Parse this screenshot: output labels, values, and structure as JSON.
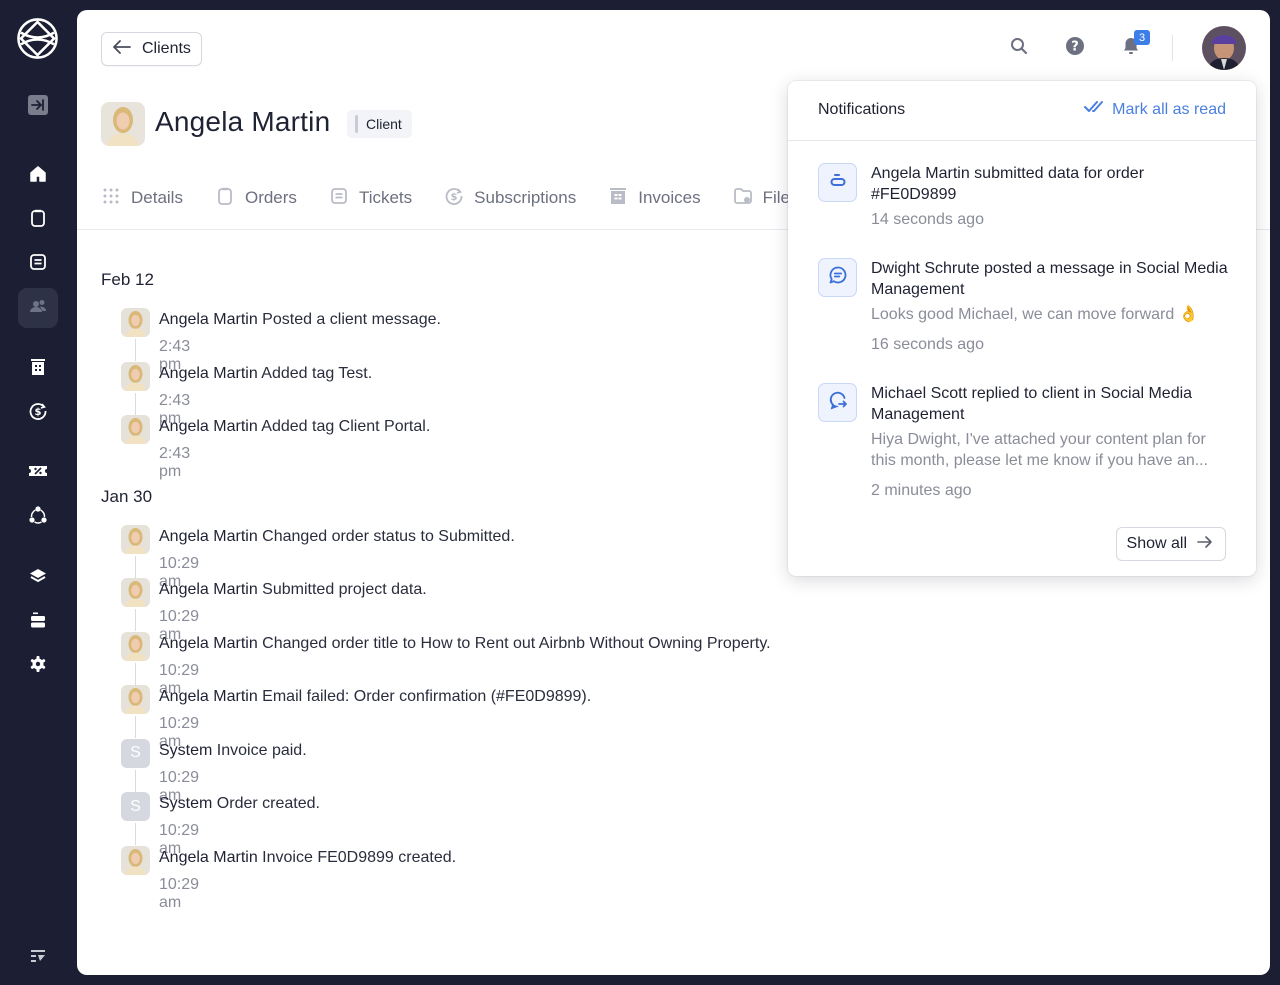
{
  "sidebar": {
    "items": [
      {
        "name": "collapse-sidebar",
        "icon": "arrow-to-right-icon",
        "active": false
      },
      {
        "name": "home",
        "icon": "home-icon",
        "active": false
      },
      {
        "name": "orders",
        "icon": "clipboard-icon",
        "active": false
      },
      {
        "name": "tickets",
        "icon": "ticket-message-icon",
        "active": false
      },
      {
        "name": "clients",
        "icon": "users-icon",
        "active": true
      },
      {
        "name": "invoices",
        "icon": "invoice-icon",
        "active": false
      },
      {
        "name": "subscriptions",
        "icon": "subscription-dollar-icon",
        "active": false
      },
      {
        "name": "coupons",
        "icon": "coupon-percent-icon",
        "active": false
      },
      {
        "name": "integrations",
        "icon": "network-icon",
        "active": false
      },
      {
        "name": "services",
        "icon": "layers-icon",
        "active": false
      },
      {
        "name": "team",
        "icon": "briefcase-icon",
        "active": false
      },
      {
        "name": "settings",
        "icon": "gear-icon",
        "active": false
      },
      {
        "name": "changelog",
        "icon": "filter-lines-icon",
        "active": false
      }
    ]
  },
  "header": {
    "back_label": "Clients",
    "notification_count": "3"
  },
  "profile": {
    "name": "Angela Martin",
    "role": "Client"
  },
  "tabs": [
    {
      "label": "Details",
      "icon": "grid-dots-icon"
    },
    {
      "label": "Orders",
      "icon": "clipboard-icon"
    },
    {
      "label": "Tickets",
      "icon": "ticket-message-icon"
    },
    {
      "label": "Subscriptions",
      "icon": "subscription-dollar-icon"
    },
    {
      "label": "Invoices",
      "icon": "invoice-icon"
    },
    {
      "label": "Files",
      "icon": "folder-icon"
    }
  ],
  "activity": [
    {
      "date": "Feb 12",
      "events": [
        {
          "actor": "Angela Martin",
          "type": "user",
          "text": "Posted a client message.",
          "time": "2:43 pm"
        },
        {
          "actor": "Angela Martin",
          "type": "user",
          "text": "Added tag Test.",
          "time": "2:43 pm"
        },
        {
          "actor": "Angela Martin",
          "type": "user",
          "text": "Added tag Client Portal.",
          "time": "2:43 pm"
        }
      ]
    },
    {
      "date": "Jan 30",
      "events": [
        {
          "actor": "Angela Martin",
          "type": "user",
          "text": "Changed order status to Submitted.",
          "time": "10:29 am"
        },
        {
          "actor": "Angela Martin",
          "type": "user",
          "text": "Submitted project data.",
          "time": "10:29 am"
        },
        {
          "actor": "Angela Martin",
          "type": "user",
          "text": "Changed order title to How to Rent out Airbnb Without Owning Property.",
          "time": "10:29 am"
        },
        {
          "actor": "Angela Martin",
          "type": "user",
          "text": "Email failed: Order confirmation (#FE0D9899).",
          "time": "10:29 am"
        },
        {
          "actor": "System",
          "type": "system",
          "initial": "S",
          "text": "Invoice paid.",
          "time": "10:29 am"
        },
        {
          "actor": "System",
          "type": "system",
          "initial": "S",
          "text": "Order created.",
          "time": "10:29 am"
        },
        {
          "actor": "Angela Martin",
          "type": "user",
          "text": "Invoice FE0D9899 created.",
          "time": "10:29 am"
        }
      ]
    }
  ],
  "notifications": {
    "title": "Notifications",
    "mark_all_label": "Mark all as read",
    "show_all_label": "Show all",
    "items": [
      {
        "icon": "order-data-icon",
        "title": "Angela Martin submitted data for order #FE0D9899",
        "preview": "",
        "time": "14 seconds ago"
      },
      {
        "icon": "message-icon",
        "title": "Dwight Schrute posted a message in Social Media Management",
        "preview": "Looks good Michael, we can move forward 👌",
        "time": "16 seconds ago"
      },
      {
        "icon": "reply-icon",
        "title": "Michael Scott replied to client in Social Media Management",
        "preview": "Hiya Dwight, I've attached your content plan for this month, please let me know if you have an...",
        "time": "2 minutes ago"
      }
    ]
  },
  "colors": {
    "sidebar_bg": "#1c1f33",
    "accent": "#4a7fe0",
    "badge": "#3c7de8"
  }
}
